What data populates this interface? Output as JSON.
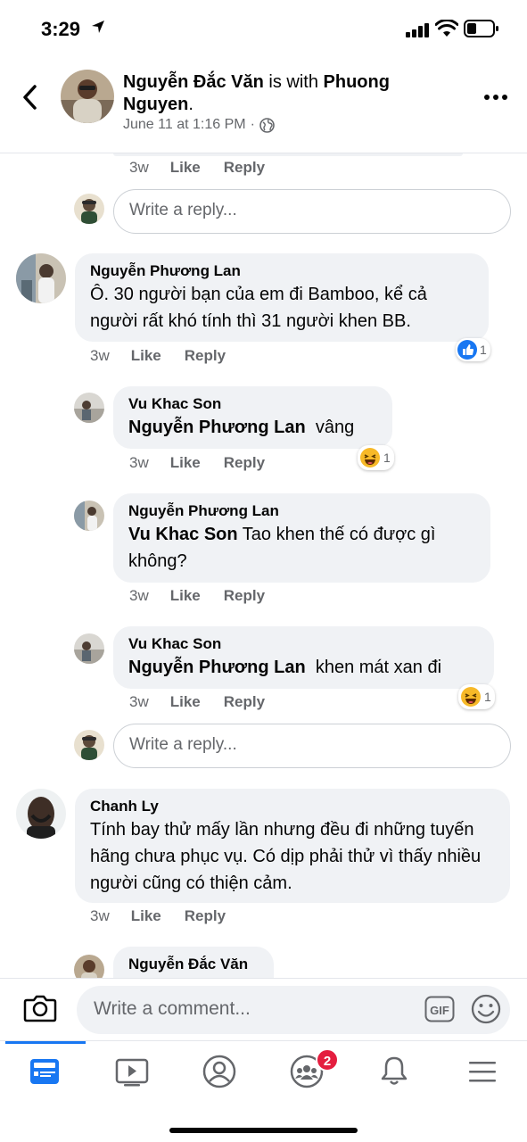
{
  "status_bar": {
    "time": "3:29"
  },
  "header": {
    "author": "Nguyễn Đắc Văn",
    "with_text": " is with ",
    "tagged": "Phuong Nguyen",
    "period": ".",
    "date": "June 11 at 1:16 PM",
    "separator": "·"
  },
  "top_actions": {
    "time": "3w",
    "like": "Like",
    "reply": "Reply"
  },
  "reply_placeholder": "Write a reply...",
  "comments": [
    {
      "author": "Nguyễn Phương Lan",
      "text": "Ô. 30 người bạn của em đi Bamboo, kể cả người rất khó tính thì 31 người khen BB.",
      "time": "3w",
      "like": "Like",
      "reply": "Reply",
      "reaction": {
        "icon": "like-reaction",
        "count": "1"
      }
    },
    {
      "author": "Vu Khac Son",
      "tag": "Nguyễn Phương Lan",
      "text": "  vâng",
      "time": "3w",
      "like": "Like",
      "reply": "Reply",
      "reaction": {
        "icon": "haha-reaction",
        "count": "1"
      }
    },
    {
      "author": "Nguyễn Phương Lan",
      "tag": "Vu Khac Son",
      "text": " Tao khen thế có được gì không?",
      "time": "3w",
      "like": "Like",
      "reply": "Reply"
    },
    {
      "author": "Vu Khac Son",
      "tag": "Nguyễn Phương Lan",
      "text": "  khen mát xan đi",
      "time": "3w",
      "like": "Like",
      "reply": "Reply",
      "reaction": {
        "icon": "haha-reaction",
        "count": "1"
      }
    },
    {
      "author": "Chanh Ly",
      "text": "Tính bay thử mấy lần nhưng đều đi những tuyến hãng chưa phục vụ. Có dịp phải thử vì thấy nhiều người cũng có thiện cảm.",
      "time": "3w",
      "like": "Like",
      "reply": "Reply"
    },
    {
      "author": "Nguyễn Đắc Văn"
    }
  ],
  "composer": {
    "placeholder": "Write a comment...",
    "gif": "GIF"
  },
  "tabbar": {
    "groups_badge": "2"
  },
  "colors": {
    "accent": "#1877f2",
    "bubble": "#f0f2f5",
    "badge": "#e41e3f",
    "secondary_text": "#65676b"
  }
}
